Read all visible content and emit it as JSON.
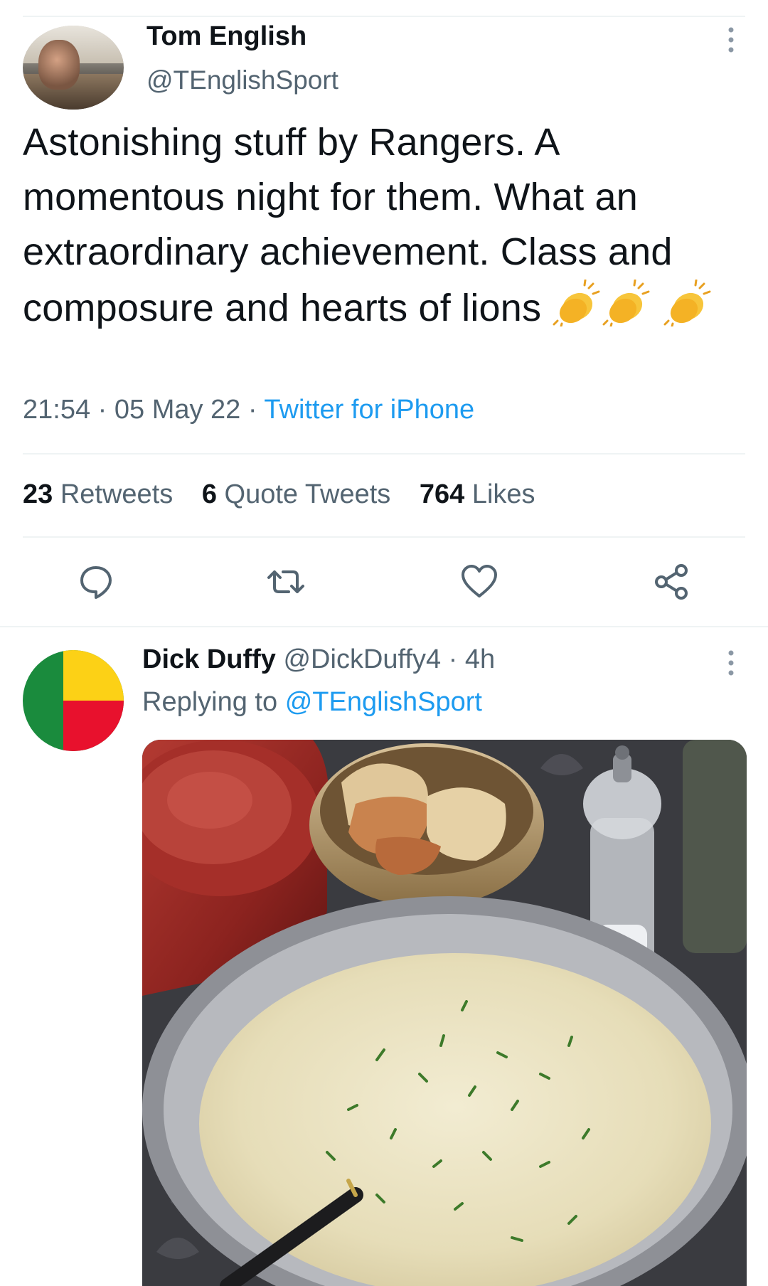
{
  "main_tweet": {
    "author_name": "Tom English",
    "author_handle": "@TEnglishSport",
    "text": "Astonishing stuff by Rangers. A momentous night for them. What an extraordinary achievement. Class and composure and hearts of lions",
    "emoji": [
      "clapping-hands",
      "clapping-hands",
      "clapping-hands"
    ],
    "time": "21:54",
    "date": "05 May 22",
    "source": "Twitter for iPhone",
    "stats": {
      "retweets_count": "23",
      "retweets_label": "Retweets",
      "quotes_count": "6",
      "quotes_label": "Quote Tweets",
      "likes_count": "764",
      "likes_label": "Likes"
    },
    "actions": [
      "reply-icon",
      "retweet-icon",
      "like-icon",
      "share-icon"
    ]
  },
  "reply": {
    "author_name": "Dick Duffy",
    "author_handle": "@DickDuffy4",
    "time": "4h",
    "replying_prefix": "Replying to",
    "replying_to": "@TEnglishSport",
    "media": "soup-photo"
  },
  "colors": {
    "link": "#1d9bf0",
    "secondary_text": "#536471",
    "divider": "#eff3f4",
    "flag_green": "#1a8b3d",
    "flag_yellow": "#fcd116",
    "flag_red": "#e8112d"
  }
}
